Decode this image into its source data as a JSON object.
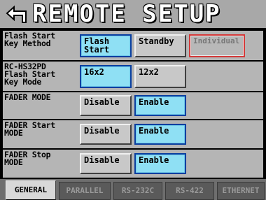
{
  "header": {
    "title": "REMOTE SETUP"
  },
  "rows": [
    {
      "label": "Flash Start\nKey Method",
      "buttons": [
        "Flash\nStart",
        "Standby",
        "Individual"
      ]
    },
    {
      "label": "RC-HS32PD\nFlash Start\nKey Mode",
      "buttons": [
        "16x2",
        "12x2"
      ]
    },
    {
      "label": "FADER MODE",
      "buttons": [
        "Disable",
        "Enable"
      ]
    },
    {
      "label": "FADER Start\nMODE",
      "buttons": [
        "Disable",
        "Enable"
      ]
    },
    {
      "label": "FADER Stop\nMODE",
      "buttons": [
        "Disable",
        "Enable"
      ]
    }
  ],
  "tabs": [
    "GENERAL",
    "PARALLEL",
    "RS-232C",
    "RS-422",
    "ETHERNET"
  ],
  "colors": {
    "selected": "#8fe0f4",
    "selected_border": "#0a3fa0",
    "disabled_border": "#d43a3a",
    "header_bg": "#a8a8a8"
  }
}
